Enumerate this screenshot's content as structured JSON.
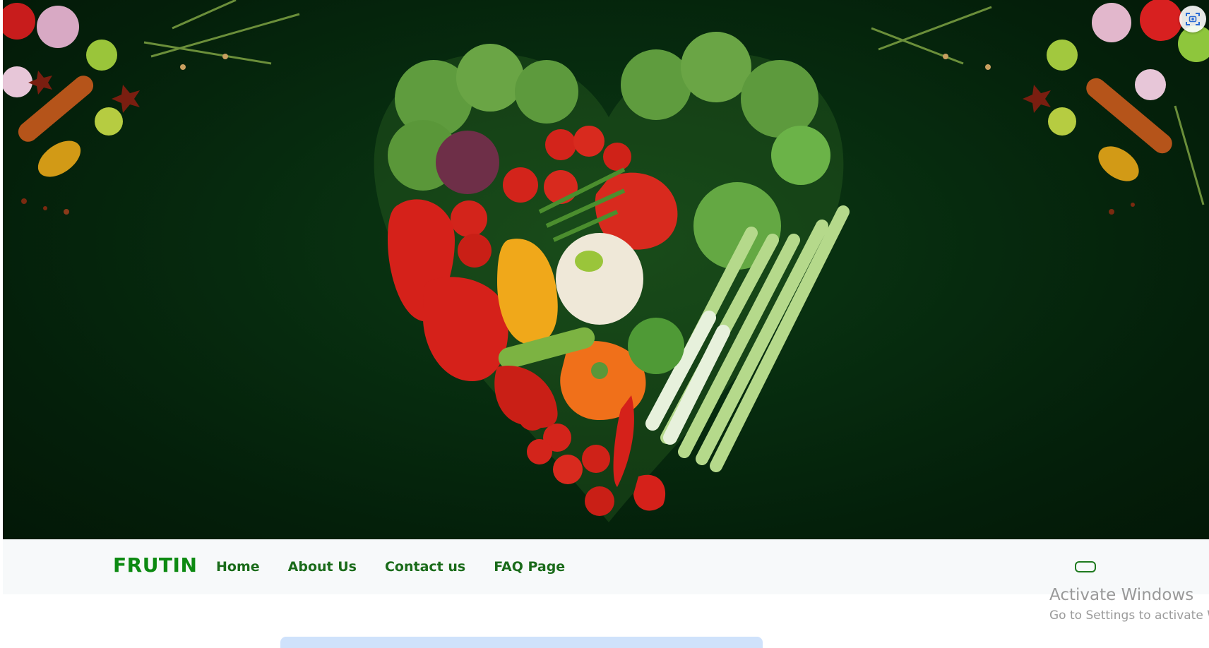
{
  "brand": {
    "name": "FRUTIN"
  },
  "nav": {
    "items": [
      {
        "label": "Home"
      },
      {
        "label": "About Us"
      },
      {
        "label": "Contact us"
      },
      {
        "label": "FAQ Page"
      }
    ]
  },
  "hero": {
    "image_icon": "heart-shaped-vegetables-image",
    "background_color": "#062a0e"
  },
  "toolbar": {
    "screenshot_icon": "screenshot-capture-icon"
  },
  "watermark": {
    "title": "Activate Windows",
    "subtitle": "Go to Settings to activate Wi"
  },
  "colors": {
    "brand": "#0d8a12",
    "nav_text": "#1a6b1a",
    "navbar_bg": "#f7f9fa",
    "card_bg": "#cfe2fb"
  }
}
